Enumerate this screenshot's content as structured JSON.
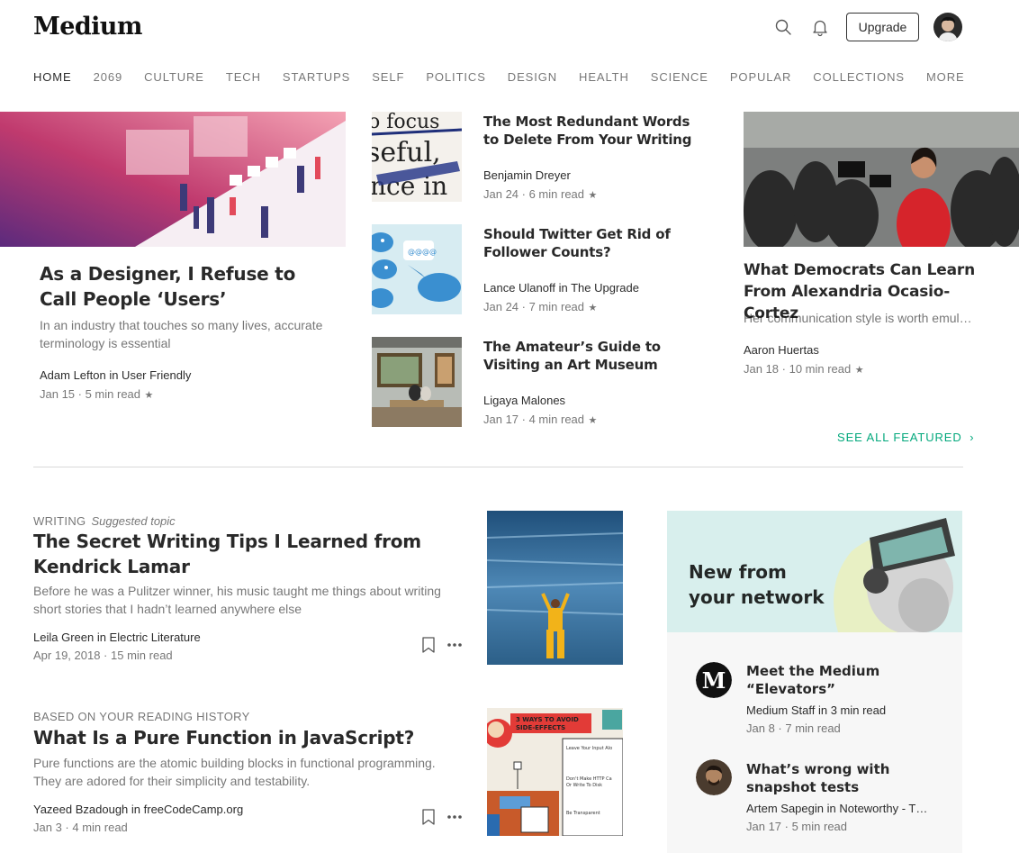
{
  "header": {
    "logo": "Medium",
    "upgrade_label": "Upgrade"
  },
  "nav": [
    "HOME",
    "2069",
    "CULTURE",
    "TECH",
    "STARTUPS",
    "SELF",
    "POLITICS",
    "DESIGN",
    "HEALTH",
    "SCIENCE",
    "POPULAR",
    "COLLECTIONS",
    "MORE"
  ],
  "featured": {
    "left": {
      "title": "As a Designer, I Refuse to Call People ‘Users’",
      "subtitle": "In an industry that touches so many lives, accurate terminology is essential",
      "author": "Adam Lefton in User Friendly",
      "meta": "Jan 15 · 5 min read"
    },
    "middle": [
      {
        "title": "The Most Redundant Words to Delete From Your Writing",
        "author": "Benjamin Dreyer",
        "meta": "Jan 24 · 6 min read"
      },
      {
        "title": "Should Twitter Get Rid of Follower Counts?",
        "author": "Lance Ulanoff in The Upgrade",
        "meta": "Jan 24 · 7 min read"
      },
      {
        "title": "The Amateur’s Guide to Visiting an Art Museum",
        "author": "Ligaya Malones",
        "meta": "Jan 17 · 4 min read"
      }
    ],
    "right": {
      "title": "What Democrats Can Learn From Alexandria Ocasio-Cortez",
      "subtitle": "Her communication style is worth emul…",
      "author": "Aaron Huertas",
      "meta": "Jan 18 · 10 min read"
    },
    "see_all": "SEE ALL FEATURED",
    "thumb_text": {
      "l1": "o focus",
      "l2": "seful,",
      "l3": "nce in"
    },
    "twitter_bubble": "@@@@"
  },
  "stream": [
    {
      "kicker": "WRITING",
      "kicker_note": "Suggested topic",
      "title": "The Secret Writing Tips I Learned from Kendrick Lamar",
      "subtitle": "Before he was a Pulitzer winner, his music taught me things about writing short stories that I hadn’t learned anywhere else",
      "author": "Leila Green in Electric Literature",
      "meta": "Apr 19, 2018 · 15 min read"
    },
    {
      "kicker": "BASED ON YOUR READING HISTORY",
      "kicker_note": "",
      "title": "What Is a Pure Function in JavaScript?",
      "subtitle": "Pure functions are the atomic building blocks in functional programming. They are adored for their simplicity and testability.",
      "author": "Yazeed Bzadough in freeCodeCamp.org",
      "meta": "Jan 3 · 4 min read",
      "thumb_title": "3 WAYS TO AVOID SIDE-EFFECTS",
      "thumb_items": [
        "Leave Your Input Alo",
        "Don't Make HTTP Ca Or Write To Disk",
        "Be Transparent"
      ]
    }
  ],
  "network": {
    "title_line1": "New from",
    "title_line2": "your network",
    "items": [
      {
        "title": "Meet the Medium “Elevators”",
        "author": "Medium Staff in 3 min read",
        "meta": "Jan 8 · 7 min read",
        "avatar_letter": "M"
      },
      {
        "title": "What’s wrong with snapshot tests",
        "author": "Artem Sapegin in Noteworthy - T…",
        "meta": "Jan 17 · 5 min read"
      }
    ]
  },
  "colors": {
    "accent": "#03a87c",
    "network_bg": "#d8efed"
  },
  "icons": [
    "search-icon",
    "bell-icon",
    "bookmark-icon",
    "more-icon",
    "star-icon",
    "chevron-right-icon"
  ]
}
